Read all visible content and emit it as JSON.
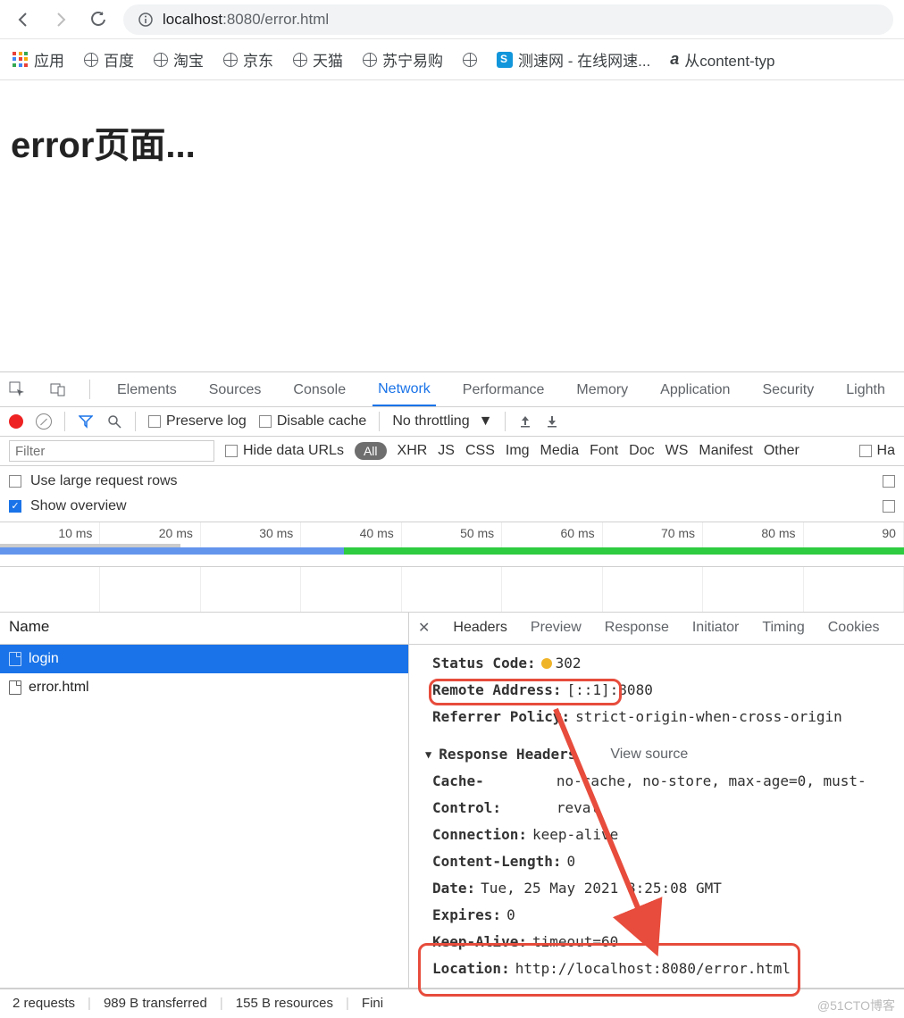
{
  "browser": {
    "url_host": "localhost",
    "url_port": ":8080",
    "url_path": "/error.html"
  },
  "bookmarks": {
    "apps": "应用",
    "items": [
      {
        "label": "百度"
      },
      {
        "label": "淘宝"
      },
      {
        "label": "京东"
      },
      {
        "label": "天猫"
      },
      {
        "label": "苏宁易购"
      },
      {
        "label": ""
      }
    ],
    "speedtest": "测速网 - 在线网速...",
    "contenttype": "从content-typ"
  },
  "page": {
    "heading": "error页面..."
  },
  "devtools": {
    "tabs": [
      "Elements",
      "Sources",
      "Console",
      "Network",
      "Performance",
      "Memory",
      "Application",
      "Security",
      "Lighth"
    ],
    "active_tab": "Network",
    "preserve_log": "Preserve log",
    "disable_cache": "Disable cache",
    "throttling": "No throttling",
    "filter_placeholder": "Filter",
    "hide_data_urls": "Hide data URLs",
    "type_filters": [
      "All",
      "XHR",
      "JS",
      "CSS",
      "Img",
      "Media",
      "Font",
      "Doc",
      "WS",
      "Manifest",
      "Other"
    ],
    "has_blocked": "Ha",
    "use_large_rows": "Use large request rows",
    "show_overview": "Show overview",
    "timeline_ticks": [
      "10 ms",
      "20 ms",
      "30 ms",
      "40 ms",
      "50 ms",
      "60 ms",
      "70 ms",
      "80 ms",
      "90"
    ],
    "name_header": "Name",
    "requests": [
      {
        "name": "login",
        "selected": true
      },
      {
        "name": "error.html",
        "selected": false
      }
    ],
    "detail_tabs": [
      "Headers",
      "Preview",
      "Response",
      "Initiator",
      "Timing",
      "Cookies"
    ],
    "headers": {
      "status_code_label": "Status Code:",
      "status_code_value": "302",
      "remote_addr_label": "Remote Address:",
      "remote_addr_value": "[::1]:8080",
      "referrer_label": "Referrer Policy:",
      "referrer_value": "strict-origin-when-cross-origin",
      "response_headers": "Response Headers",
      "view_source": "View source",
      "cache_control_label": "Cache-Control:",
      "cache_control_value": "no-cache, no-store, max-age=0, must-reval",
      "connection_label": "Connection:",
      "connection_value": "keep-alive",
      "content_length_label": "Content-Length:",
      "content_length_value": "0",
      "date_label": "Date:",
      "date_value": "Tue, 25 May 2021  8:25:08 GMT",
      "expires_label": "Expires:",
      "expires_value": "0",
      "keep_alive_label": "Keep-Alive:",
      "keep_alive_value": "timeout=60",
      "location_label": "Location:",
      "location_value": "http://localhost:8080/error.html"
    },
    "status_bar": {
      "requests": "2 requests",
      "transferred": "989 B transferred",
      "resources": "155 B resources",
      "finish": "Fini"
    }
  },
  "watermark": "@51CTO博客"
}
